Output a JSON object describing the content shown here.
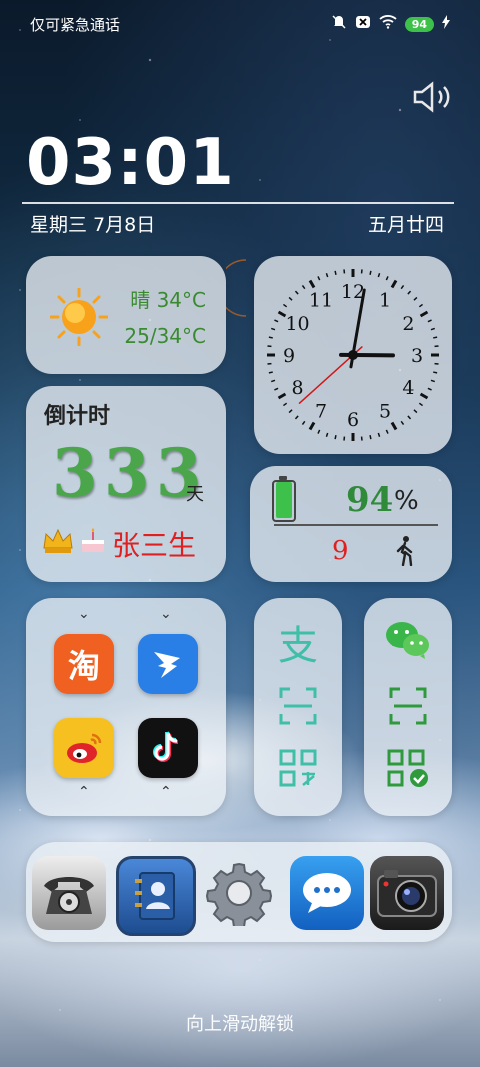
{
  "status_bar": {
    "carrier_text": "仅可紧急通话",
    "battery_level": "94"
  },
  "lockscreen": {
    "time": "03:01",
    "date": "星期三  7月8日",
    "lunar_date": "五月廿四",
    "unlock_hint": "向上滑动解锁"
  },
  "weather": {
    "condition_temp": "晴 34°C",
    "range": "25/34°C",
    "icon": "sun-icon"
  },
  "analog_clock": {
    "hour": 3,
    "minute": 1,
    "second": 38
  },
  "countdown": {
    "title": "倒计时",
    "days": "333",
    "unit": "天",
    "name": "张三生"
  },
  "battery_widget": {
    "level": "94",
    "unit": "%",
    "level_fraction": 0.94,
    "steps": "9"
  },
  "apps": [
    {
      "name": "taobao-app-icon",
      "glyph": "淘",
      "color": "#f06020"
    },
    {
      "name": "dingtalk-app-icon",
      "glyph": "",
      "color": "#2a7fe6"
    },
    {
      "name": "weibo-app-icon",
      "glyph": "",
      "color": "#f5c020"
    },
    {
      "name": "douyin-app-icon",
      "glyph": "",
      "color": "#111111"
    }
  ],
  "alipay_shortcuts": {
    "logo": "支",
    "scan_icon": "scan-icon",
    "qr_icon": "payment-code-icon"
  },
  "wechat_shortcuts": {
    "logo_icon": "wechat-icon",
    "scan_icon": "scan-icon",
    "qr_icon": "payment-code-icon"
  },
  "dock": [
    {
      "name": "phone-app-icon"
    },
    {
      "name": "contacts-app-icon"
    },
    {
      "name": "settings-app-icon"
    },
    {
      "name": "messages-app-icon"
    },
    {
      "name": "camera-app-icon"
    }
  ],
  "colors": {
    "accent_green": "#3a8a30",
    "countdown_red": "#e02020",
    "battery_green": "#3ec14a"
  }
}
